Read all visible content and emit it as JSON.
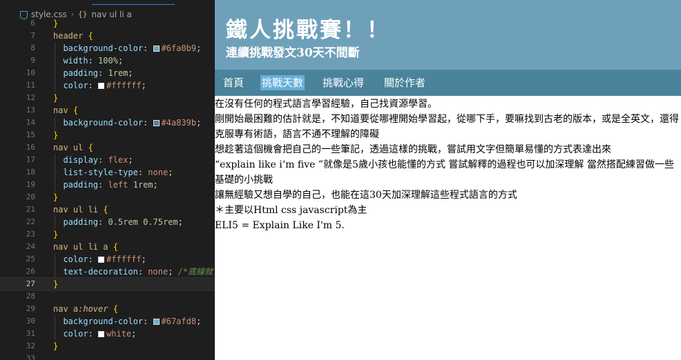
{
  "editor": {
    "breadcrumb": {
      "file": "style.css",
      "symbol": "nav ul li a"
    },
    "lines": [
      {
        "n": "6",
        "text": "}"
      },
      {
        "n": "7",
        "text": "header {"
      },
      {
        "n": "8",
        "text": "background-color: #6fa0b9;"
      },
      {
        "n": "9",
        "text": "width: 100%;"
      },
      {
        "n": "10",
        "text": "padding: 1rem;"
      },
      {
        "n": "11",
        "text": "color: #ffffff;"
      },
      {
        "n": "12",
        "text": "}"
      },
      {
        "n": "13",
        "text": "nav {"
      },
      {
        "n": "14",
        "text": "background-color: #4a839b;"
      },
      {
        "n": "15",
        "text": "}"
      },
      {
        "n": "16",
        "text": "nav ul {"
      },
      {
        "n": "17",
        "text": "display: flex;"
      },
      {
        "n": "18",
        "text": "list-style-type: none;"
      },
      {
        "n": "19",
        "text": "padding: left 1rem;"
      },
      {
        "n": "20",
        "text": "}"
      },
      {
        "n": "21",
        "text": "nav ul li {"
      },
      {
        "n": "22",
        "text": "padding: 0.5rem 0.75rem;"
      },
      {
        "n": "23",
        "text": "}"
      },
      {
        "n": "24",
        "text": "nav ul li a {"
      },
      {
        "n": "25",
        "text": "color: #ffffff;"
      },
      {
        "n": "26",
        "text": "text-decoration: none; /*底線就"
      },
      {
        "n": "27",
        "text": "}"
      },
      {
        "n": "28",
        "text": ""
      },
      {
        "n": "29",
        "text": "nav a:hover {"
      },
      {
        "n": "30",
        "text": "background-color: #67afd8;"
      },
      {
        "n": "31",
        "text": "color: white;"
      },
      {
        "n": "32",
        "text": "}"
      },
      {
        "n": "33",
        "text": ""
      }
    ],
    "swatches": {
      "header_bg": "#6fa0b9",
      "white": "#ffffff",
      "nav_bg": "#4a839b",
      "hover_bg": "#67afd8"
    }
  },
  "preview": {
    "title": "鐵人挑戰賽！！",
    "subtitle": "連續挑戰發文30天不間斷",
    "nav": [
      {
        "label": "首頁"
      },
      {
        "label": "挑戰天數"
      },
      {
        "label": "挑戰心得"
      },
      {
        "label": "關於作者"
      }
    ],
    "paragraphs": [
      "在沒有任何的程式語言學習經驗，自己找資源學習。",
      "剛開始最困難的估計就是，不知道要從哪裡開始學習起，從哪下手，要嘛找到古老的版本，或是全英文，還得克服專有術語，語言不通不理解的障礙",
      "想趁著這個機會把自己的一些筆記，透過這樣的挑戰，嘗試用文字但簡單易懂的方式表達出來",
      "“explain like i‘m five ”就像是5歲小孩也能懂的方式 嘗試解釋的過程也可以加深理解 當然搭配練習做一些基礎的小挑戰",
      "讓無經驗又想自學的自己，也能在這30天加深理解這些程式語言的方式",
      " ＊主要以Html css javascript為主",
      "ELI5 = Explain Like I'm 5."
    ]
  }
}
